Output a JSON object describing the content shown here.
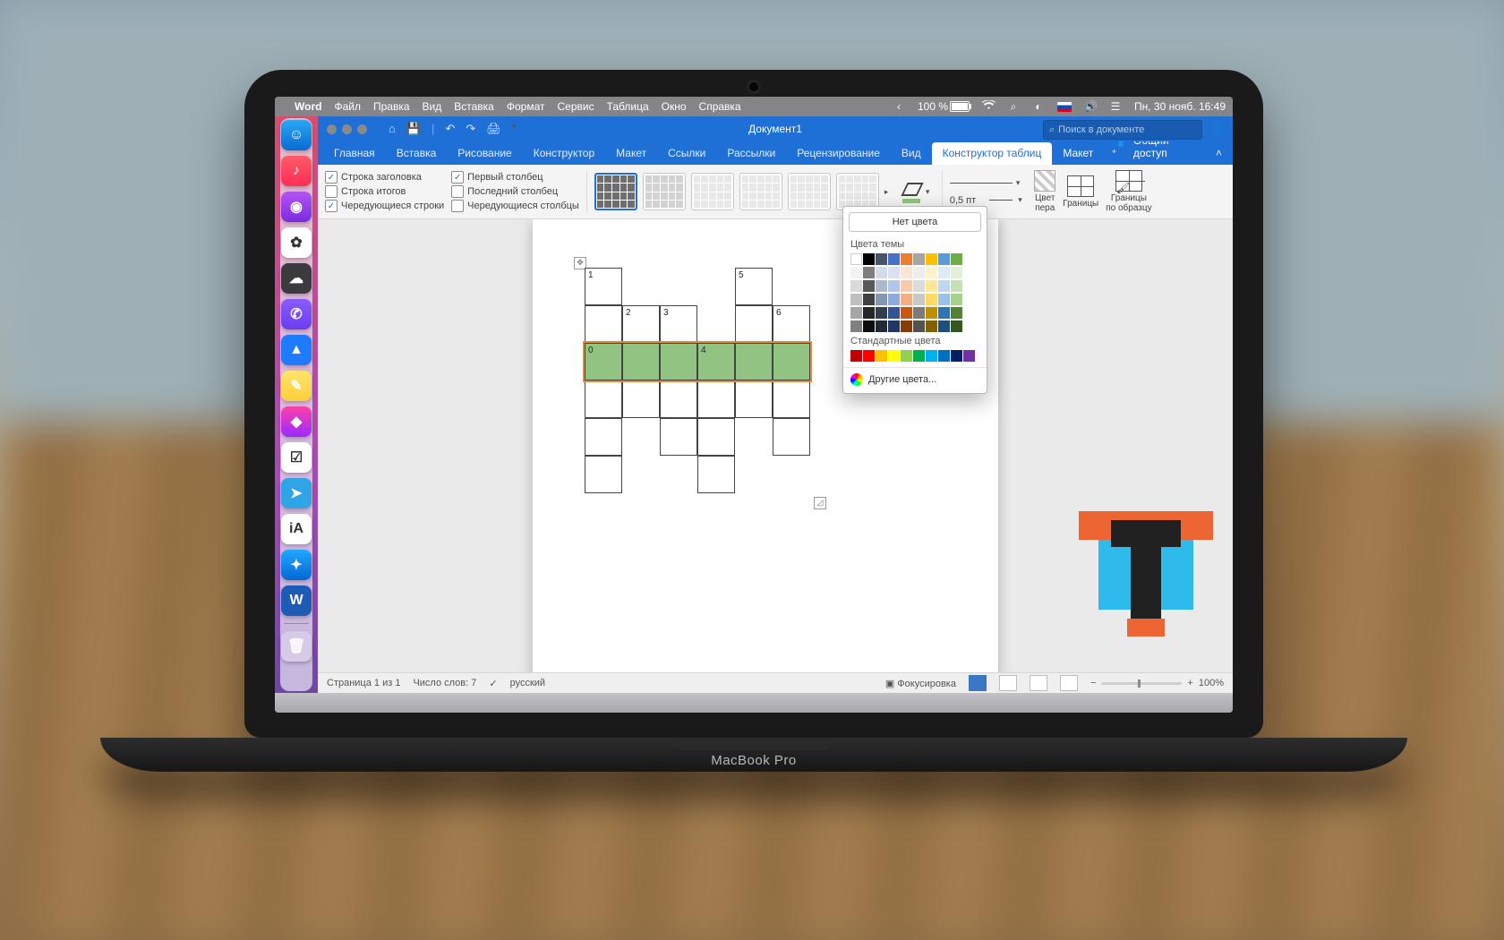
{
  "menubar": {
    "app": "Word",
    "items": [
      "Файл",
      "Правка",
      "Вид",
      "Вставка",
      "Формат",
      "Сервис",
      "Таблица",
      "Окно",
      "Справка"
    ],
    "battery": "100 %",
    "datetime": "Пн, 30 нояб.  16:49"
  },
  "titlebar": {
    "document": "Документ1",
    "search_placeholder": "Поиск в документе"
  },
  "ribbon_tabs": {
    "items": [
      "Главная",
      "Вставка",
      "Рисование",
      "Конструктор",
      "Макет",
      "Ссылки",
      "Рассылки",
      "Рецензирование",
      "Вид"
    ],
    "context_active": "Конструктор таблиц",
    "context_other": "Макет",
    "share": "Общий доступ"
  },
  "table_options": {
    "header_row": {
      "label": "Строка заголовка",
      "checked": true
    },
    "total_row": {
      "label": "Строка итогов",
      "checked": false
    },
    "banded_rows": {
      "label": "Чередующиеся строки",
      "checked": true
    },
    "first_col": {
      "label": "Первый столбец",
      "checked": true
    },
    "last_col": {
      "label": "Последний столбец",
      "checked": false
    },
    "banded_cols": {
      "label": "Чередующиеся столбцы",
      "checked": false
    }
  },
  "border_labels": {
    "pen_color": "Цвет\nпера",
    "borders": "Границы",
    "border_painter": "Границы\nпо образцу",
    "line_weight": "0,5 пт"
  },
  "color_popover": {
    "no_color": "Нет цвета",
    "theme": "Цвета темы",
    "theme_row_main": [
      "#ffffff",
      "#000000",
      "#44546a",
      "#4472c4",
      "#ed7d31",
      "#a5a5a5",
      "#ffc000",
      "#5b9bd5",
      "#70ad47"
    ],
    "theme_shades": [
      [
        "#f2f2f2",
        "#7f7f7f",
        "#d6dce5",
        "#d9e1f2",
        "#fce4d6",
        "#ededed",
        "#fff2cc",
        "#ddebf7",
        "#e2efda"
      ],
      [
        "#d9d9d9",
        "#595959",
        "#acb9ca",
        "#b4c6e7",
        "#f8cbad",
        "#dbdbdb",
        "#ffe699",
        "#bdd7ee",
        "#c6e0b4"
      ],
      [
        "#bfbfbf",
        "#404040",
        "#8497b0",
        "#8ea9db",
        "#f4b084",
        "#c9c9c9",
        "#ffd966",
        "#9bc2e6",
        "#a9d08e"
      ],
      [
        "#a6a6a6",
        "#262626",
        "#333f4f",
        "#305496",
        "#c65911",
        "#7b7b7b",
        "#bf8f00",
        "#2f75b5",
        "#548235"
      ],
      [
        "#808080",
        "#0d0d0d",
        "#222b35",
        "#203764",
        "#833c0c",
        "#525252",
        "#806000",
        "#1f4e78",
        "#375623"
      ]
    ],
    "standard": "Стандартные цвета",
    "standard_row": [
      "#c00000",
      "#ff0000",
      "#ffc000",
      "#ffff00",
      "#92d050",
      "#00b050",
      "#00b0f0",
      "#0070c0",
      "#002060",
      "#7030a0"
    ],
    "more": "Другие цвета..."
  },
  "crossword": {
    "highlight_fill": "#91c483",
    "cells": [
      {
        "c": 0,
        "r": 0,
        "n": "1"
      },
      {
        "c": 4,
        "r": 0,
        "n": "5"
      },
      {
        "c": 0,
        "r": 1,
        "n": ""
      },
      {
        "c": 1,
        "r": 1,
        "n": "2"
      },
      {
        "c": 2,
        "r": 1,
        "n": "3"
      },
      {
        "c": 4,
        "r": 1,
        "n": ""
      },
      {
        "c": 5,
        "r": 1,
        "n": "6"
      },
      {
        "c": 0,
        "r": 2,
        "n": "0",
        "hl": true
      },
      {
        "c": 1,
        "r": 2,
        "n": "",
        "hl": true
      },
      {
        "c": 2,
        "r": 2,
        "n": "",
        "hl": true
      },
      {
        "c": 3,
        "r": 2,
        "n": "4",
        "hl": true
      },
      {
        "c": 4,
        "r": 2,
        "n": "",
        "hl": true
      },
      {
        "c": 5,
        "r": 2,
        "n": "",
        "hl": true
      },
      {
        "c": 0,
        "r": 3,
        "n": ""
      },
      {
        "c": 1,
        "r": 3,
        "n": ""
      },
      {
        "c": 2,
        "r": 3,
        "n": ""
      },
      {
        "c": 3,
        "r": 3,
        "n": ""
      },
      {
        "c": 4,
        "r": 3,
        "n": ""
      },
      {
        "c": 5,
        "r": 3,
        "n": ""
      },
      {
        "c": 0,
        "r": 4,
        "n": ""
      },
      {
        "c": 2,
        "r": 4,
        "n": ""
      },
      {
        "c": 3,
        "r": 4,
        "n": ""
      },
      {
        "c": 5,
        "r": 4,
        "n": ""
      },
      {
        "c": 0,
        "r": 5,
        "n": ""
      },
      {
        "c": 3,
        "r": 5,
        "n": ""
      }
    ]
  },
  "status": {
    "page": "Страница 1 из 1",
    "words": "Число слов: 7",
    "lang": "русский",
    "focus": "Фокусировка",
    "zoom": "100%"
  },
  "dock": {
    "items": [
      {
        "name": "finder",
        "bg": "linear-gradient(#2aa7f5,#0a6bd1)",
        "glyph": "☺"
      },
      {
        "name": "music",
        "bg": "linear-gradient(#ff5b69,#ff2d55)",
        "glyph": "♪"
      },
      {
        "name": "podcasts",
        "bg": "linear-gradient(#b453f3,#7a2be0)",
        "glyph": "◉"
      },
      {
        "name": "photos",
        "bg": "#ffffff",
        "glyph": "✿"
      },
      {
        "name": "cloud",
        "bg": "#3b3b3f",
        "glyph": "☁"
      },
      {
        "name": "viber",
        "bg": "linear-gradient(#8a5cff,#6a3df0)",
        "glyph": "✆"
      },
      {
        "name": "maps",
        "bg": "#1d7bff",
        "glyph": "▲"
      },
      {
        "name": "notes",
        "bg": "linear-gradient(#ffe36b,#ffcf3a)",
        "glyph": "✎"
      },
      {
        "name": "affinity",
        "bg": "linear-gradient(#ff3fa9,#9a2bff)",
        "glyph": "◆"
      },
      {
        "name": "things",
        "bg": "#ffffff",
        "glyph": "☑"
      },
      {
        "name": "telegram",
        "bg": "#2fa4e7",
        "glyph": "➤"
      },
      {
        "name": "ia",
        "bg": "#ffffff",
        "glyph": "iA"
      },
      {
        "name": "safari",
        "bg": "linear-gradient(#1fa9ff,#0567d4)",
        "glyph": "✦"
      },
      {
        "name": "word",
        "bg": "#1e5bb4",
        "glyph": "W"
      }
    ],
    "trash": "🗑"
  },
  "base_label": "MacBook Pro"
}
